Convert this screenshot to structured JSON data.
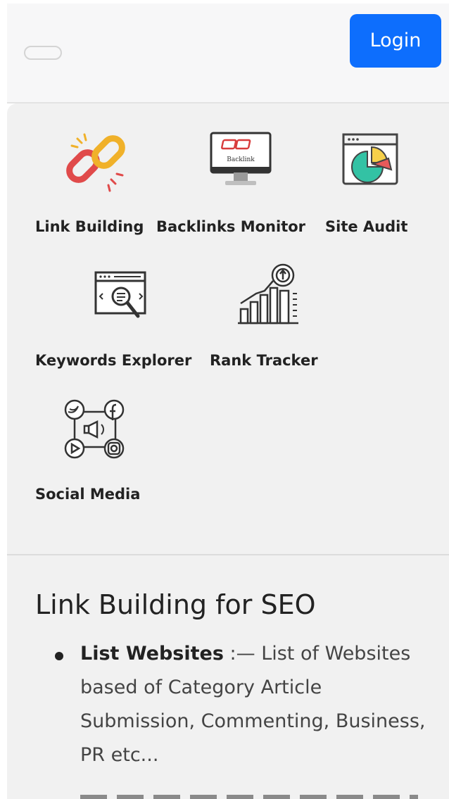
{
  "navbar": {
    "login_label": "Login"
  },
  "tools": [
    {
      "label": "Link Building",
      "icon": "chain-link-icon"
    },
    {
      "label": "Backlinks Monitor",
      "icon": "backlink-monitor-icon",
      "screen_text": "Backlink"
    },
    {
      "label": "Site Audit",
      "icon": "pie-chart-window-icon"
    },
    {
      "label": "Keywords Explorer",
      "icon": "magnifier-window-icon"
    },
    {
      "label": "Rank Tracker",
      "icon": "rising-bar-chart-icon"
    },
    {
      "label": "Social Media",
      "icon": "social-network-icon"
    }
  ],
  "article": {
    "title": "Link Building for SEO",
    "items": [
      {
        "strong": "List Websites",
        "separator": " :— ",
        "text": "List of Websites based of Category Article Submission, Commenting, Business, PR etc..."
      }
    ]
  },
  "colors": {
    "primary": "#0d6efd",
    "panel_bg": "#f1f1f1",
    "navbar_bg": "#f7f7f8",
    "text": "#222222"
  }
}
